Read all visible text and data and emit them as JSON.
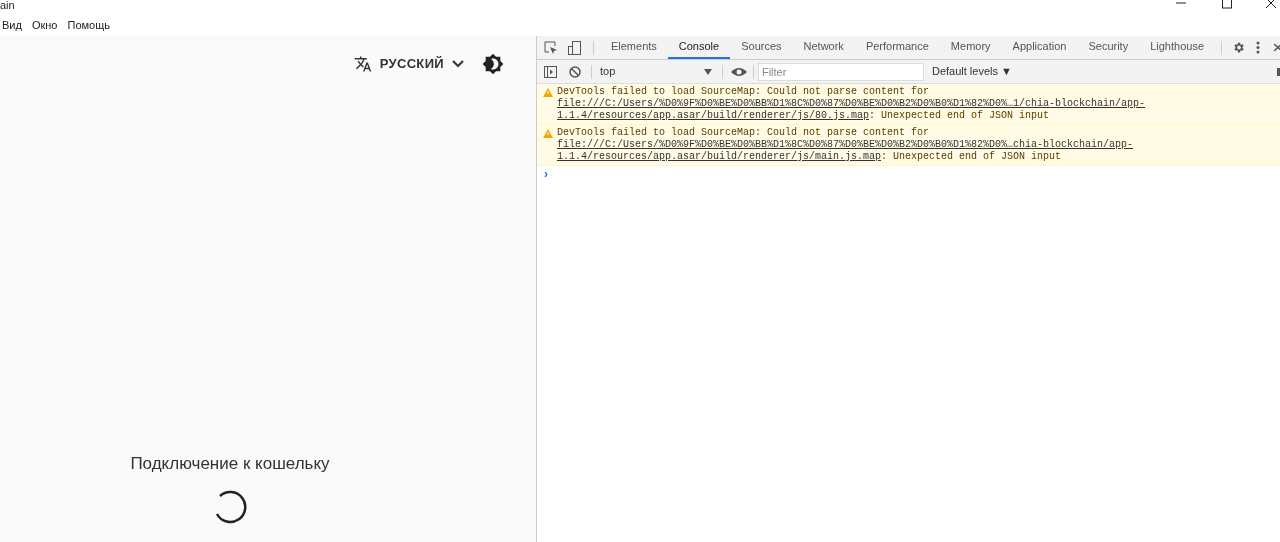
{
  "window": {
    "title": "ain"
  },
  "menu": [
    "Вид",
    "Окно",
    "Помощь"
  ],
  "app": {
    "language": "РУССКИЙ",
    "status": "Подключение к кошельку"
  },
  "devtools": {
    "tabs": [
      {
        "label": "Elements",
        "selected": false
      },
      {
        "label": "Console",
        "selected": true
      },
      {
        "label": "Sources",
        "selected": false
      },
      {
        "label": "Network",
        "selected": false
      },
      {
        "label": "Performance",
        "selected": false
      },
      {
        "label": "Memory",
        "selected": false
      },
      {
        "label": "Application",
        "selected": false
      },
      {
        "label": "Security",
        "selected": false
      },
      {
        "label": "Lighthouse",
        "selected": false
      }
    ],
    "context": "top",
    "filter": {
      "placeholder": "Filter"
    },
    "levels": "Default levels ▼",
    "messages": [
      {
        "kind": "warning",
        "text": "DevTools failed to load SourceMap: Could not parse content for ",
        "link": "file:///C:/Users/%D0%9F%D0%BE%D0%BB%D1%8C%D0%87%D0%BE%D0%B2%D0%B0%D1%82%D0%…1/chia-blockchain/app-1.1.4/resources/app.asar/build/renderer/js/80.js.map",
        "suffix": ": Unexpected end of JSON input"
      },
      {
        "kind": "warning",
        "text": "DevTools failed to load SourceMap: Could not parse content for ",
        "link": "file:///C:/Users/%D0%9F%D0%BE%D0%BB%D1%8C%D0%87%D0%BE%D0%B2%D0%B0%D1%82%D0%…chia-blockchain/app-1.1.4/resources/app.asar/build/renderer/js/main.js.map",
        "suffix": ": Unexpected end of JSON input"
      }
    ],
    "prompt": "›"
  }
}
